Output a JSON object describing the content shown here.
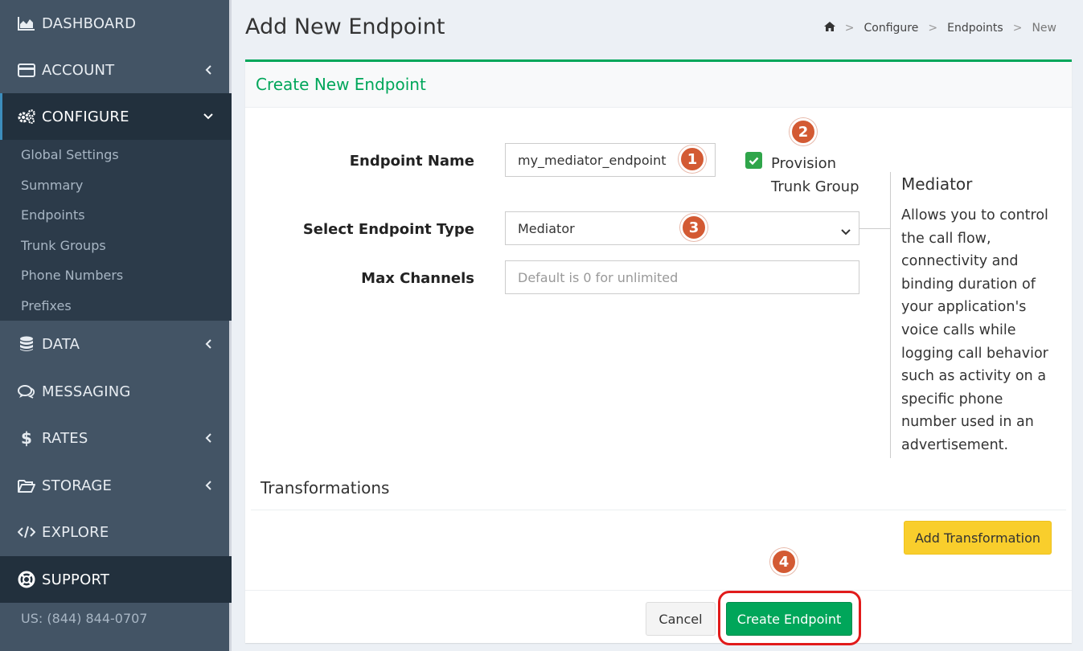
{
  "sidebar": {
    "items": [
      {
        "label": "DASHBOARD",
        "icon": "area-chart-icon"
      },
      {
        "label": "ACCOUNT",
        "icon": "credit-card-icon",
        "chevron": "left"
      },
      {
        "label": "CONFIGURE",
        "icon": "cogs-icon",
        "chevron": "down",
        "active": true
      },
      {
        "label": "DATA",
        "icon": "database-icon",
        "chevron": "left"
      },
      {
        "label": "MESSAGING",
        "icon": "chat-bubbles-icon"
      },
      {
        "label": "RATES",
        "icon": "dollar-icon",
        "chevron": "left"
      },
      {
        "label": "STORAGE",
        "icon": "folder-open-icon",
        "chevron": "left"
      },
      {
        "label": "EXPLORE",
        "icon": "code-icon"
      },
      {
        "label": "SUPPORT",
        "icon": "life-ring-icon"
      }
    ],
    "submenu": [
      "Global Settings",
      "Summary",
      "Endpoints",
      "Trunk Groups",
      "Phone Numbers",
      "Prefixes"
    ],
    "phone": "US: (844) 844-0707"
  },
  "header": {
    "title": "Add New Endpoint",
    "breadcrumb": [
      "Configure",
      "Endpoints",
      "New"
    ]
  },
  "card": {
    "title": "Create New Endpoint"
  },
  "form": {
    "endpoint_name_label": "Endpoint Name",
    "endpoint_name_value": "my_mediator_endpoint",
    "provision_label_line1": "Provision",
    "provision_label_line2": "Trunk Group",
    "provision_checked": true,
    "type_label": "Select Endpoint Type",
    "type_value": "Mediator",
    "max_channels_label": "Max Channels",
    "max_channels_placeholder": "Default is 0 for unlimited"
  },
  "info": {
    "title": "Mediator",
    "body": "Allows you to control the call flow, connectivity and binding duration of your application's voice calls while logging call behavior such as activity on a specific phone number used in an advertisement."
  },
  "transformations": {
    "title": "Transformations",
    "add_button": "Add Transformation"
  },
  "footer": {
    "cancel": "Cancel",
    "create": "Create Endpoint"
  },
  "badges": [
    "1",
    "2",
    "3",
    "4"
  ],
  "colors": {
    "sidebar_bg": "#435465",
    "sidebar_active": "#22303d",
    "accent_green": "#00a65a",
    "badge": "#d35a33",
    "highlight": "#e11b1b",
    "yellow_button": "#f9ce2c"
  }
}
